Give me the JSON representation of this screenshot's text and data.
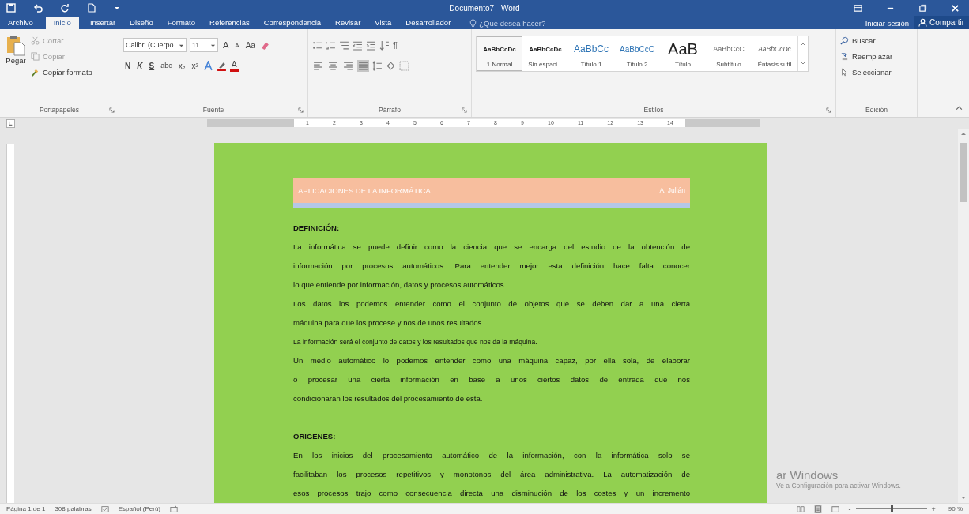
{
  "window": {
    "title": "Documento7 - Word"
  },
  "tabs": [
    {
      "label": "Archivo",
      "selected": false
    },
    {
      "label": "Inicio",
      "selected": true
    },
    {
      "label": "Insertar",
      "selected": false
    },
    {
      "label": "Diseño",
      "selected": false
    },
    {
      "label": "Formato",
      "selected": false
    },
    {
      "label": "Referencias",
      "selected": false
    },
    {
      "label": "Correspondencia",
      "selected": false
    },
    {
      "label": "Revisar",
      "selected": false
    },
    {
      "label": "Vista",
      "selected": false
    },
    {
      "label": "Desarrollador",
      "selected": false
    }
  ],
  "tell_me": {
    "placeholder": "¿Qué desea hacer?"
  },
  "account": {
    "sign_in": "Iniciar sesión",
    "share": "Compartir"
  },
  "clipboard": {
    "label": "Portapapeles",
    "paste": "Pegar",
    "cut": "Cortar",
    "copy": "Copiar",
    "format_painter": "Copiar formato"
  },
  "font": {
    "label": "Fuente",
    "name": "Calibri (Cuerpo",
    "size": "11",
    "row1": [
      {
        "label": "A",
        "kind": "grow"
      },
      {
        "label": "A",
        "kind": "shrink"
      },
      {
        "label": "Aa",
        "kind": "case"
      }
    ],
    "row2": [
      {
        "label": "N",
        "kind": "bold"
      },
      {
        "label": "K",
        "kind": "italic"
      },
      {
        "label": "S",
        "kind": "underline"
      },
      {
        "label": "abc",
        "kind": "strike"
      },
      {
        "label": "x₂",
        "kind": "sub"
      },
      {
        "label": "x²",
        "kind": "sup"
      }
    ],
    "color_letter": "A"
  },
  "paragraph": {
    "label": "Párrafo",
    "pilcrow": "¶",
    "alignment": [
      {
        "kind": "left",
        "selected": false
      },
      {
        "kind": "center",
        "selected": false
      },
      {
        "kind": "right",
        "selected": false
      },
      {
        "kind": "justify",
        "selected": true
      }
    ]
  },
  "styles": {
    "label": "Estilos",
    "items": [
      {
        "sample": "AaBbCcDc",
        "name": "1 Normal",
        "kind": "normal",
        "selected": true
      },
      {
        "sample": "AaBbCcDc",
        "name": "Sin espaci...",
        "kind": "nospacing",
        "selected": false
      },
      {
        "sample": "AaBbCc",
        "name": "Título 1",
        "kind": "heading1",
        "selected": false
      },
      {
        "sample": "AaBbCcC",
        "name": "Título 2",
        "kind": "heading2",
        "selected": false
      },
      {
        "sample": "AaB",
        "name": "Título",
        "kind": "title",
        "selected": false
      },
      {
        "sample": "AaBbCcC",
        "name": "Subtítulo",
        "kind": "subtitle",
        "selected": false
      },
      {
        "sample": "AaBbCcDc",
        "name": "Énfasis sutil",
        "kind": "emphasis",
        "selected": false
      }
    ]
  },
  "editing": {
    "label": "Edición",
    "find": "Buscar",
    "replace": "Reemplazar",
    "select": "Seleccionar"
  },
  "ruler": {
    "numbers": [
      "1",
      "2",
      "3",
      "4",
      "5",
      "6",
      "7",
      "8",
      "9",
      "10",
      "11",
      "12",
      "13",
      "14"
    ]
  },
  "document": {
    "header_title": "APLICACIONES DE LA INFORMÁTICA",
    "header_author": "A. Julián",
    "blocks": [
      {
        "kind": "heading",
        "text": "DEFINICIÓN:"
      },
      {
        "kind": "paragraph",
        "continues": false,
        "lines": [
          "La informática se puede definir como la ciencia que se encarga del estudio de la obtención de",
          "información por procesos automáticos. Para entender mejor esta definición hace falta conocer",
          "lo que entiende por información, datos y procesos automáticos."
        ]
      },
      {
        "kind": "paragraph",
        "continues": false,
        "lines": [
          "Los datos los podemos entender como el conjunto de objetos que se deben dar a una cierta",
          "máquina para que los procese y nos de unos resultados."
        ]
      },
      {
        "kind": "small",
        "continues": false,
        "lines": [
          "La información será el conjunto de datos y los resultados que nos da la máquina."
        ]
      },
      {
        "kind": "paragraph",
        "continues": false,
        "lines": [
          "Un medio automático lo podemos entender como una máquina capaz, por ella sola, de elaborar",
          "o procesar una cierta información en base a unos ciertos datos de entrada que nos",
          "condicionarán los resultados del procesamiento de esta."
        ]
      },
      {
        "kind": "spacer"
      },
      {
        "kind": "heading",
        "text": "ORÍGENES:"
      },
      {
        "kind": "paragraph",
        "continues": true,
        "lines": [
          "En los inicios del procesamiento automático de la información, con la informática solo se",
          "facilitaban los procesos repetitivos y monotonos del área administrativa. La automatización de",
          "esos procesos trajo como consecuencia directa una disminución de los costes y un incremento"
        ]
      }
    ]
  },
  "activation": {
    "title": "ar Windows",
    "hint": "Ve a Configuración para activar Windows."
  },
  "status_bar": {
    "page": "Página 1 de 1",
    "words": "308 palabras",
    "language": "Español (Perú)",
    "zoom": "90 %",
    "zoom_out": "-",
    "zoom_in": "+",
    "zoom_slider": {
      "level": 0.5
    }
  }
}
